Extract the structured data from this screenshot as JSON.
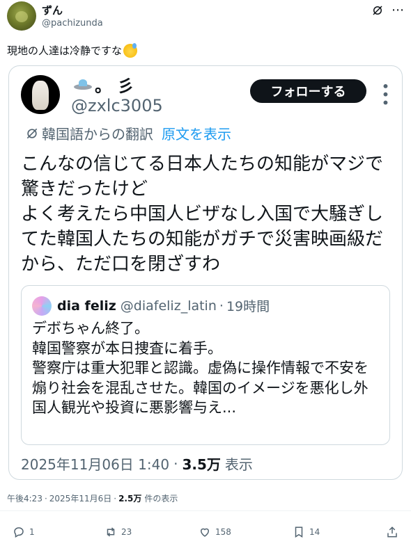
{
  "post": {
    "author_name": "ずん",
    "author_handle": "@pachizunda",
    "text": "現地の人達は冷静ですな",
    "emoji": "sweat-smile-emoji"
  },
  "quoted": {
    "name_suffix": "。 彡",
    "handle": "@zxlc3005",
    "follow_label": "フォローする",
    "translation_label": "韓国語からの翻訳",
    "show_original_label": "原文を表示",
    "body": "こんなの信じてる日本人たちの知能がマジで驚きだったけど\nよく考えたら中国人ビザなし入国で大騒ぎしてた韓国人たちの知能がガチで災害映画級だから、ただ口を閉ざすわ",
    "inner": {
      "name": "dia feliz",
      "handle": "@diafeliz_latin",
      "time": "19時間",
      "body": "デボちゃん終了。\n韓国警察が本日捜査に着手。\n警察庁は重大犯罪と認識。虚偽に操作情報で不安を煽り社会を混乱させた。韓国のイメージを悪化し外国人観光や投資に悪影響与え..."
    },
    "date": "2025年11月06日 1:40",
    "views": "3.5万",
    "views_label": "表示"
  },
  "meta": {
    "time": "午後4:23",
    "date": "2025年11月6日",
    "views": "2.5万",
    "views_label": "件の表示"
  },
  "actions": {
    "replies": "1",
    "reposts": "23",
    "likes": "158",
    "bookmarks": "14"
  },
  "colors": {
    "text": "#0f1419",
    "secondary": "#536471",
    "link": "#1d9bf0",
    "border": "#cfd9de"
  }
}
